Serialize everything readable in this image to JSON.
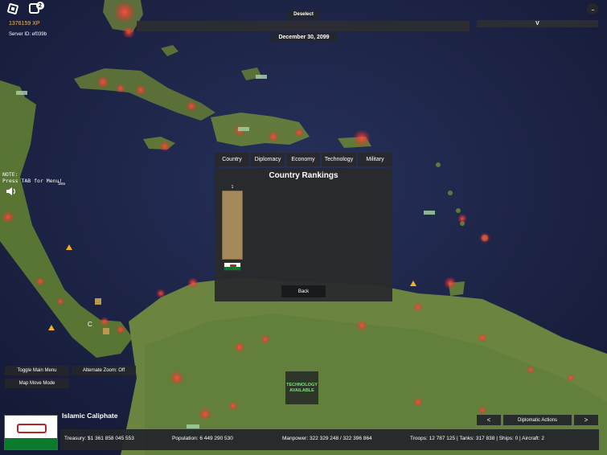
{
  "top": {
    "deselect_label": "Deselect",
    "date": "December 30, 2099",
    "player_info": "V",
    "xp": "1376159 XP",
    "server_id": "Server ID: ef039b",
    "chat_badge": "2",
    "menu_dots": "..."
  },
  "note": {
    "line1": "NOTE:",
    "line2": "Press TAB for Menu!"
  },
  "map_labels": {
    "sea": "Sea",
    "c_marker": "C"
  },
  "rankings": {
    "tabs": [
      "Country",
      "Diplomacy",
      "Economy",
      "Technology",
      "Military"
    ],
    "title": "Country Rankings",
    "entries": [
      {
        "rank": "1",
        "value_fraction": 1.0
      }
    ],
    "back_label": "Back"
  },
  "bottom_left": {
    "toggle_main_menu": "Toggle Main Menu",
    "alternate_zoom": "Alternate Zoom: Off",
    "map_move_mode": "Map Move Mode"
  },
  "technology": {
    "line1": "TECHNOLOGY",
    "line2": "AVAILABLE"
  },
  "country": {
    "name": "Islamic Caliphate"
  },
  "stats": {
    "treasury": "Treasury:  $1 361 858 045 553",
    "population": "Population: 6 449 290 530",
    "manpower": "Manpower: 322 329 248  /  322 396 864",
    "troops": "Troops: 12 787 125  |  Tanks: 317 838  |  Ships: 0  |  Aircraft: 2"
  },
  "diplomacy": {
    "prev": "<",
    "label": "Diplomatic Actions",
    "next": ">"
  },
  "colors": {
    "ocean": "#1b2244",
    "land": "#5d7a3a",
    "city_glow": "#ff3b30",
    "rank_bar": "#a4895a",
    "panel": "#292a2c",
    "tech_text": "#7fe07f",
    "xp_text": "#ffb84c"
  }
}
